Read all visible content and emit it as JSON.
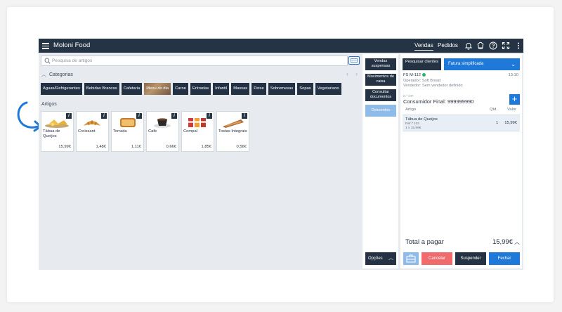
{
  "app": {
    "title": "Moloni Food",
    "nav": {
      "sales": "Vendas",
      "orders": "Pedidos"
    },
    "icons": [
      "bell-icon",
      "chef-icon",
      "help-icon",
      "fullscreen-icon",
      "more-icon"
    ]
  },
  "search": {
    "placeholder": "Pesquisa de artigos"
  },
  "categories": {
    "title": "Categorias",
    "items": [
      "Aguas/Refrigerantes",
      "Bebidas Brancas",
      "Cafetaria",
      "Menu do dia",
      "Carne",
      "Entradas",
      "Infantil",
      "Massas",
      "Peixe",
      "Sobremesas",
      "Sopas",
      "Vegetariano"
    ]
  },
  "articles": {
    "title": "Artigos",
    "items": [
      {
        "name": "Tábua de Queijos",
        "price": "15,99€"
      },
      {
        "name": "Croissant",
        "price": "1,48€"
      },
      {
        "name": "Torrada",
        "price": "1,11€"
      },
      {
        "name": "Cafe",
        "price": "0,66€"
      },
      {
        "name": "Compal",
        "price": "1,85€"
      },
      {
        "name": "Tostas Integrais",
        "price": "0,56€"
      }
    ]
  },
  "actions": {
    "suspended": "Vendas suspensas",
    "cash_moves": "Movimentos de caixa",
    "consult_docs": "Consultar documentos",
    "discounts": "Descontos",
    "options": "Opções"
  },
  "document": {
    "search_clients": "Pesquisar clientes",
    "type": "Fatura simplificada",
    "id": "FS M-112",
    "time": "13:10",
    "operator": "Operador: Soft Bread",
    "seller": "Vendedor: Sem vendedor definido",
    "nif_label": "N.º NIF",
    "client": "Consumidor Final: 999999990",
    "columns": {
      "article": "Artigo",
      "qty": "Qtd.",
      "value": "Valor"
    },
    "lines": [
      {
        "name": "Tábua de Queijos",
        "ref": "Ref.ª 102",
        "unit": "1 x 15,99€",
        "qty": "1",
        "value": "15,99€"
      }
    ],
    "total_label": "Total a pagar",
    "total_value": "15,99€",
    "buttons": {
      "cancel": "Cancelar",
      "suspend": "Suspender",
      "close": "Fechar"
    }
  },
  "colors": {
    "navy": "#253444",
    "blue": "#1e79d8",
    "danger": "#f06b6b",
    "light_blue": "#8fbbe8"
  }
}
